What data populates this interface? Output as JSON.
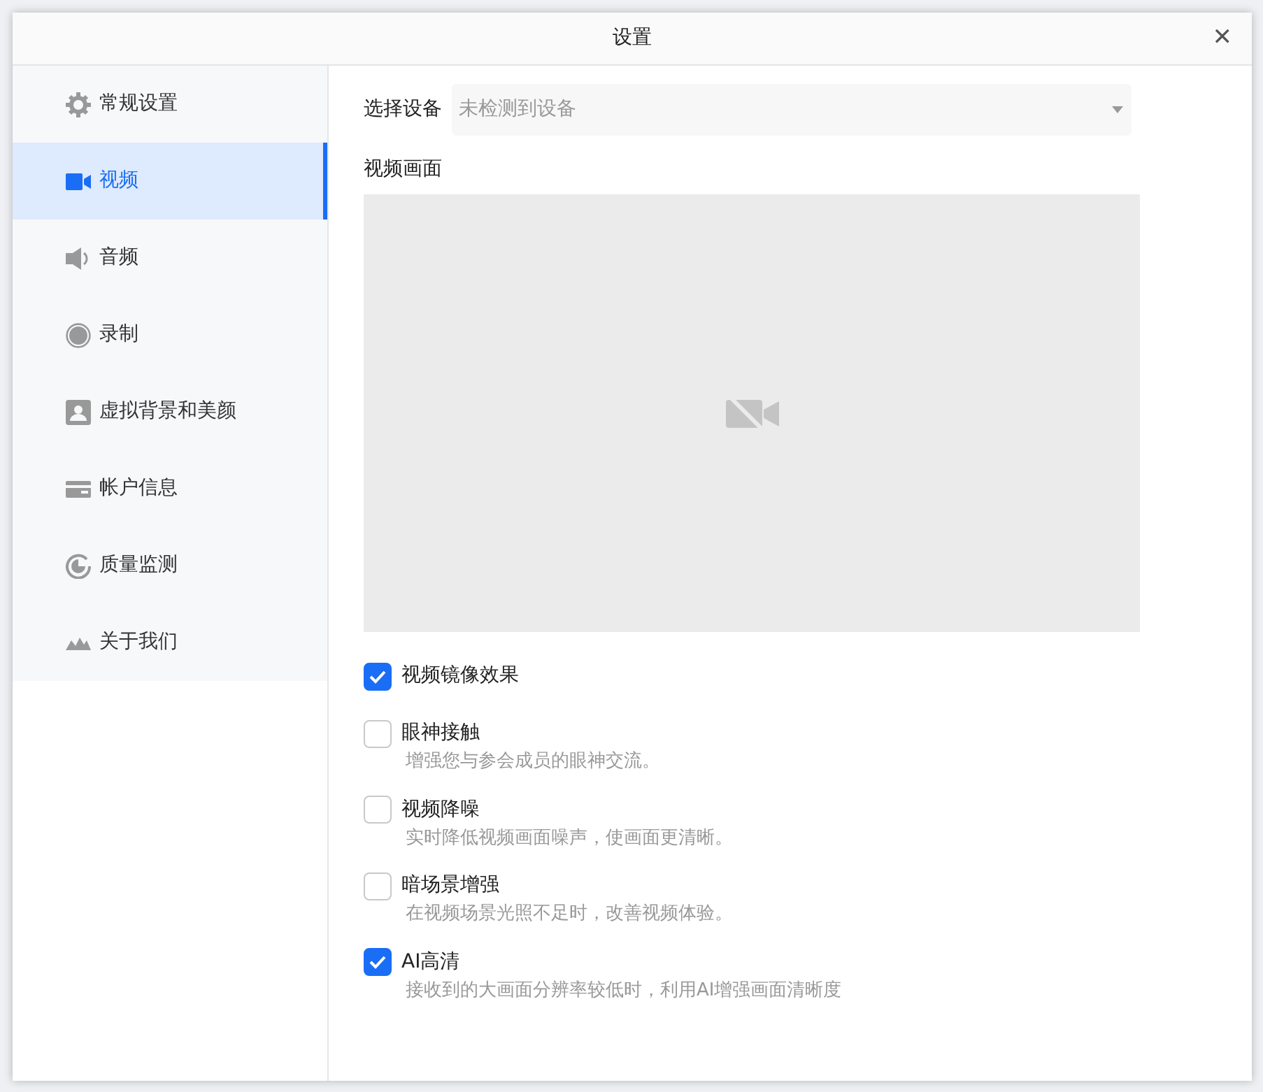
{
  "window": {
    "title": "设置",
    "close": "✕"
  },
  "sidebar": {
    "items": [
      {
        "label": "常规设置",
        "selected": false
      },
      {
        "label": "视频",
        "selected": true
      },
      {
        "label": "音频",
        "selected": false
      },
      {
        "label": "录制",
        "selected": false
      },
      {
        "label": "虚拟背景和美颜",
        "selected": false
      },
      {
        "label": "帐户信息",
        "selected": false
      },
      {
        "label": "质量监测",
        "selected": false
      },
      {
        "label": "关于我们",
        "selected": false
      }
    ]
  },
  "device": {
    "label": "选择设备",
    "placeholder": "未检测到设备"
  },
  "preview": {
    "label": "视频画面"
  },
  "options": [
    {
      "label": "视频镜像效果",
      "checked": true
    },
    {
      "label": "眼神接触",
      "checked": false,
      "description": "增强您与参会成员的眼神交流。"
    },
    {
      "label": "视频降噪",
      "checked": false,
      "description": "实时降低视频画面噪声，使画面更清晰。"
    },
    {
      "label": "暗场景增强",
      "checked": false,
      "description": "在视频场景光照不足时，改善视频体验。"
    },
    {
      "label": "AI高清",
      "checked": true,
      "description": "接收到的大画面分辨率较低时，利用AI增强画面清晰度"
    }
  ]
}
